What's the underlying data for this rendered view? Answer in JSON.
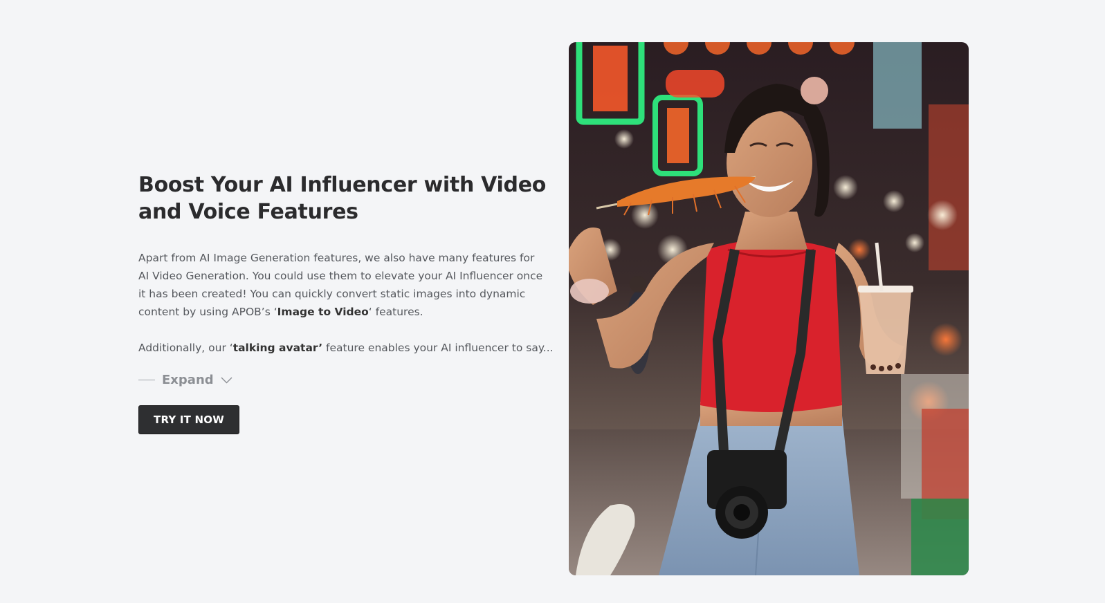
{
  "feature": {
    "heading_line1": "Boost Your AI Influencer with Video",
    "heading_line2": "and Voice Features",
    "p1_part1": "Apart from AI Image Generation features, we also have many features for AI Video Generation. You could use them to elevate your AI Influencer once it has been created! You can quickly convert static images into dynamic content by using APOB’s ‘",
    "p1_bold": "Image to Video",
    "p1_part2": "‘ features.",
    "p2_part1": "Additionally, our ‘",
    "p2_bold": "talking avatar’",
    "p2_part2": " feature enables your AI influencer to say...",
    "expand_label": "Expand",
    "cta_label": "TRY IT NOW"
  },
  "photo": {
    "subject": "woman-eating-shrimp-skewer-at-night-market",
    "icon": "photo-image"
  },
  "colors": {
    "background": "#f4f5f7",
    "heading": "#2b2b2d",
    "body_text": "#55585d",
    "button_bg": "#2e2f31",
    "button_text": "#ffffff",
    "expand_text": "#8c8f94"
  }
}
